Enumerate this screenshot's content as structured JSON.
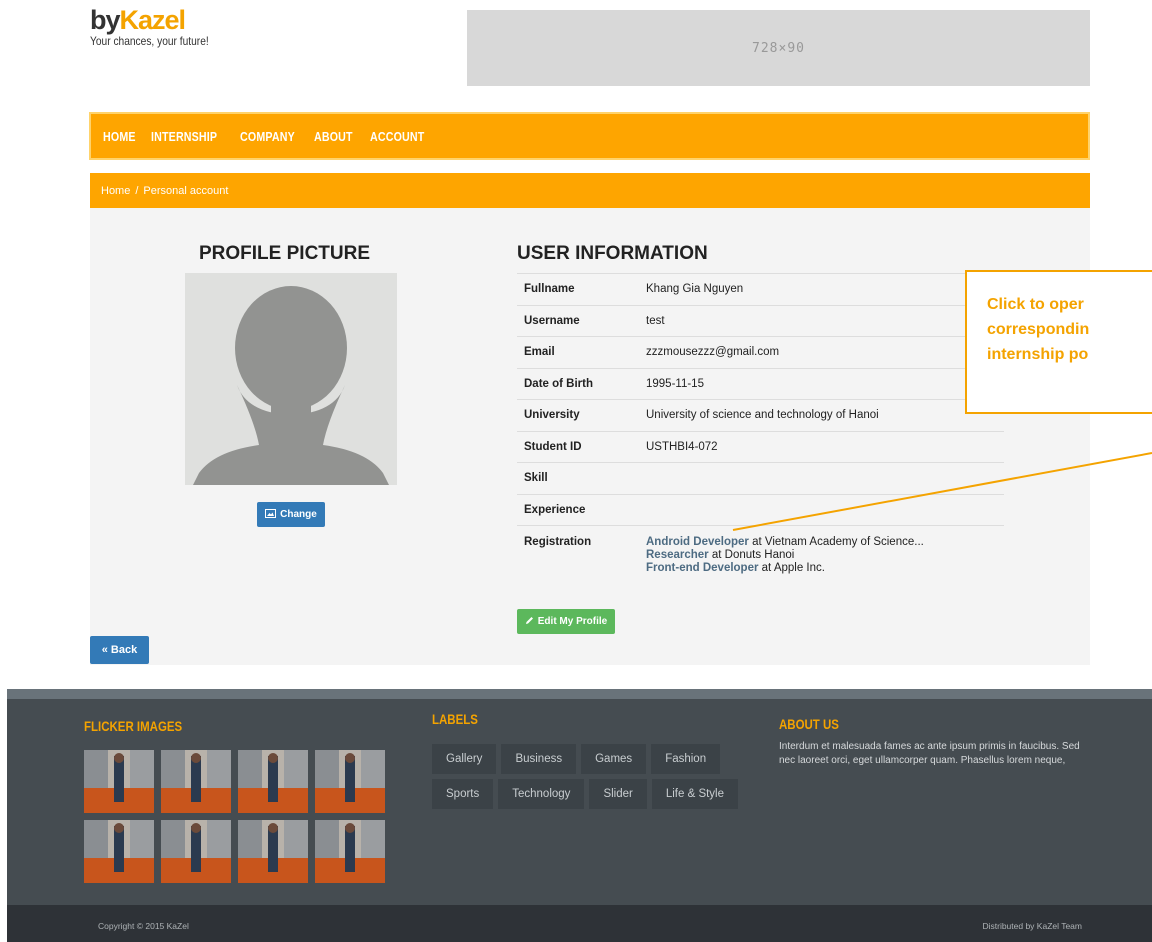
{
  "header": {
    "brand_by": "by",
    "brand_name": "Kazel",
    "tagline": "Your chances, your future!",
    "ad_placeholder": "728×90"
  },
  "nav": {
    "items": [
      "HOME",
      "INTERNSHIP",
      "COMPANY",
      "ABOUT",
      "ACCOUNT"
    ]
  },
  "breadcrumb": {
    "home": "Home",
    "separator": "/",
    "current": "Personal account"
  },
  "profile": {
    "title": "PROFILE PICTURE",
    "change_label": "Change",
    "back_label": "« Back"
  },
  "user_info": {
    "title": "USER INFORMATION",
    "rows": [
      {
        "key": "Fullname",
        "value": "Khang Gia Nguyen"
      },
      {
        "key": "Username",
        "value": "test"
      },
      {
        "key": "Email",
        "value": "zzzmousezzz@gmail.com"
      },
      {
        "key": "Date of Birth",
        "value": "1995-11-15"
      },
      {
        "key": "University",
        "value": "University of science and technology of Hanoi"
      },
      {
        "key": "Student ID",
        "value": "USTHBI4-072"
      },
      {
        "key": "Skill",
        "value": ""
      },
      {
        "key": "Experience",
        "value": ""
      }
    ],
    "registration_label": "Registration",
    "registrations": [
      {
        "position": "Android Developer",
        "at": " at ",
        "company": "Vietnam Academy of Science..."
      },
      {
        "position": "Researcher",
        "at": " at ",
        "company": "Donuts Hanoi"
      },
      {
        "position": "Front-end Developer",
        "at": " at ",
        "company": "Apple Inc."
      }
    ],
    "edit_label": "Edit My Profile"
  },
  "annotation": {
    "line1": "Click to oper",
    "line2": "correspondin",
    "line3": "internship po"
  },
  "colors": {
    "accent": "#fea500",
    "primary": "#337ab7",
    "success": "#5cb85c",
    "footer": "#454c51"
  },
  "footer": {
    "flicker_title": "FLICKER IMAGES",
    "labels_title": "LABELS",
    "labels": [
      "Gallery",
      "Business",
      "Games",
      "Fashion",
      "Sports",
      "Technology",
      "Slider",
      "Life & Style"
    ],
    "about_title": "ABOUT US",
    "about_text": "Interdum et malesuada fames ac ante ipsum primis in faucibus. Sed nec laoreet orci, eget ullamcorper quam. Phasellus lorem neque,",
    "copyright": "Copyright © 2015 KaZel",
    "distributed": "Distributed by KaZel Team"
  }
}
